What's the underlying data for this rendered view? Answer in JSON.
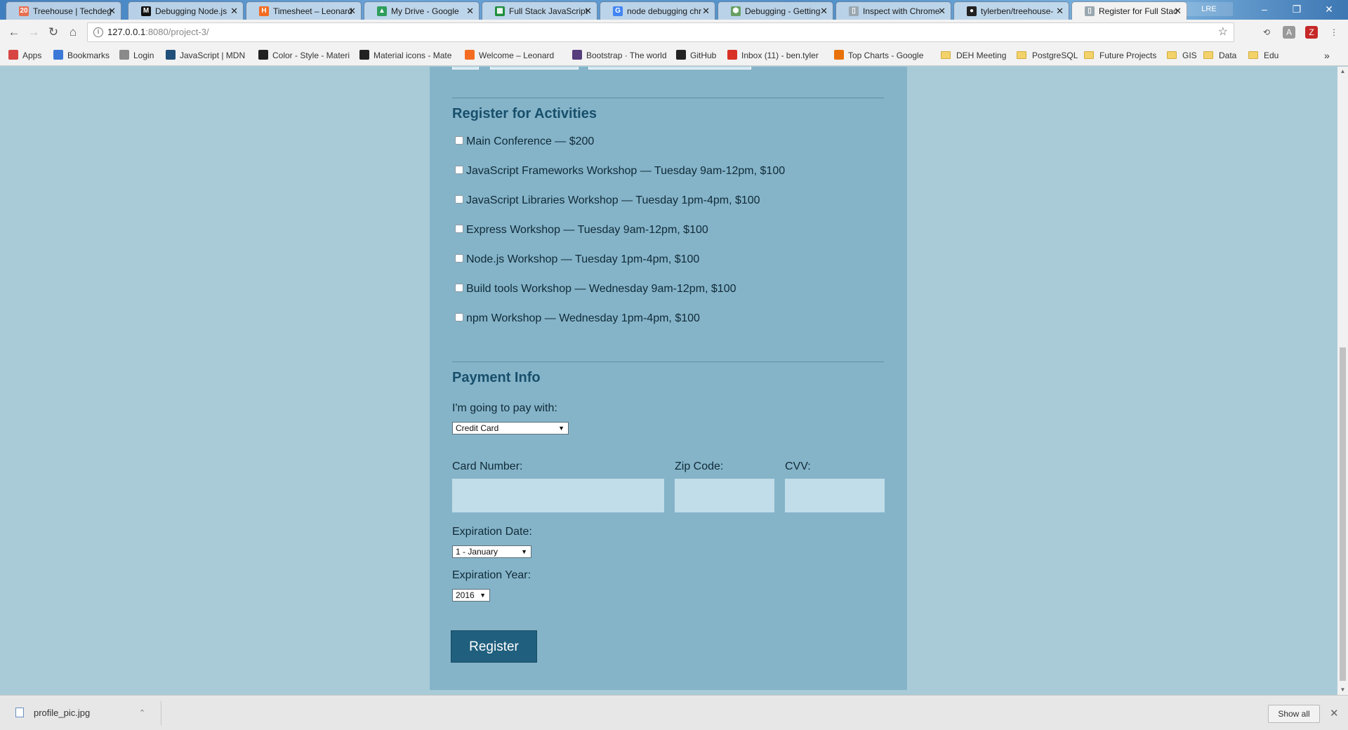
{
  "tabs": [
    {
      "title": "Treehouse | Techdeg",
      "icon": "treehouse-icon",
      "icon_text": "20",
      "color": "#e76f51"
    },
    {
      "title": "Debugging Node.js",
      "icon": "medium-icon",
      "icon_text": "M",
      "color": "#111111"
    },
    {
      "title": "Timesheet – Leonard",
      "icon": "harvest-icon",
      "icon_text": "H",
      "color": "#f36c21"
    },
    {
      "title": "My Drive - Google",
      "icon": "google-drive-icon",
      "icon_text": "▲",
      "color": "#2f9e5b"
    },
    {
      "title": "Full Stack JavaScript",
      "icon": "google-sheets-icon",
      "icon_text": "▦",
      "color": "#1e8e3e"
    },
    {
      "title": "node debugging chr",
      "icon": "google-icon",
      "icon_text": "G",
      "color": "#4285f4"
    },
    {
      "title": "Debugging - Getting",
      "icon": "nodejs-icon",
      "icon_text": "⬢",
      "color": "#68a063"
    },
    {
      "title": "Inspect with Chrome",
      "icon": "page-icon",
      "icon_text": "▯",
      "color": "#9aa7b0"
    },
    {
      "title": "tylerben/treehouse-",
      "icon": "github-icon",
      "icon_text": "●",
      "color": "#222222"
    },
    {
      "title": "Register for Full Stac",
      "icon": "page-icon",
      "icon_text": "▯",
      "color": "#9aa7b0"
    }
  ],
  "profile_label": "LRE",
  "window_controls": {
    "minimize": "–",
    "restore": "❐",
    "close": "✕"
  },
  "address_bar": {
    "host": "127.0.0.1",
    "port_path": ":8080/project-3/"
  },
  "bookmarks": [
    {
      "label": "Apps",
      "icon": "apps-grid-icon",
      "color": "#d64541",
      "folder": false
    },
    {
      "label": "Bookmarks",
      "icon": "star-icon",
      "color": "#3b78d8",
      "folder": false
    },
    {
      "label": "Login",
      "icon": "login-icon",
      "color": "#8a8a8a",
      "folder": false
    },
    {
      "label": "JavaScript | MDN",
      "icon": "mdn-icon",
      "color": "#1f4f7a",
      "folder": false
    },
    {
      "label": "Color - Style - Materi",
      "icon": "github-icon",
      "color": "#222222",
      "folder": false
    },
    {
      "label": "Material icons - Mate",
      "icon": "github-icon",
      "color": "#222222",
      "folder": false
    },
    {
      "label": "Welcome – Leonard",
      "icon": "harvest-icon",
      "color": "#f36c21",
      "folder": false
    },
    {
      "label": "Bootstrap · The world",
      "icon": "bootstrap-icon",
      "color": "#563d7c",
      "folder": false
    },
    {
      "label": "GitHub",
      "icon": "github-icon",
      "color": "#222222",
      "folder": false
    },
    {
      "label": "Inbox (11) - ben.tyler",
      "icon": "gmail-icon",
      "color": "#d93025",
      "folder": false
    },
    {
      "label": "Top Charts - Google",
      "icon": "google-play-icon",
      "color": "#e8710a",
      "folder": false
    },
    {
      "label": "DEH Meeting",
      "icon": "folder-icon",
      "color": "#f3d26a",
      "folder": true
    },
    {
      "label": "PostgreSQL",
      "icon": "folder-icon",
      "color": "#f3d26a",
      "folder": true
    },
    {
      "label": "Future Projects",
      "icon": "folder-icon",
      "color": "#f3d26a",
      "folder": true
    },
    {
      "label": "GIS",
      "icon": "folder-icon",
      "color": "#f3d26a",
      "folder": true
    },
    {
      "label": "Data",
      "icon": "folder-icon",
      "color": "#f3d26a",
      "folder": true
    },
    {
      "label": "Edu",
      "icon": "folder-icon",
      "color": "#f3d26a",
      "folder": true
    }
  ],
  "bookmarks_overflow": "»",
  "form": {
    "activities_title": "Register for Activities",
    "activities": [
      {
        "label": "Main Conference — $200",
        "checked": false
      },
      {
        "label": "JavaScript Frameworks Workshop — Tuesday 9am-12pm, $100",
        "checked": false
      },
      {
        "label": "JavaScript Libraries Workshop — Tuesday 1pm-4pm, $100",
        "checked": false
      },
      {
        "label": "Express Workshop — Tuesday 9am-12pm, $100",
        "checked": false
      },
      {
        "label": "Node.js Workshop — Tuesday 1pm-4pm, $100",
        "checked": false
      },
      {
        "label": "Build tools Workshop — Wednesday 9am-12pm, $100",
        "checked": false
      },
      {
        "label": "npm Workshop — Wednesday 1pm-4pm, $100",
        "checked": false
      }
    ],
    "payment_title": "Payment Info",
    "pay_with_label": "I'm going to pay with:",
    "pay_with_value": "Credit Card",
    "card_number_label": "Card Number:",
    "card_number_value": "",
    "zip_label": "Zip Code:",
    "zip_value": "",
    "cvv_label": "CVV:",
    "cvv_value": "",
    "exp_date_label": "Expiration Date:",
    "exp_date_value": "1 - January",
    "exp_year_label": "Expiration Year:",
    "exp_year_value": "2016",
    "register_label": "Register"
  },
  "download_shelf": {
    "file_name": "profile_pic.jpg",
    "show_all_label": "Show all"
  }
}
